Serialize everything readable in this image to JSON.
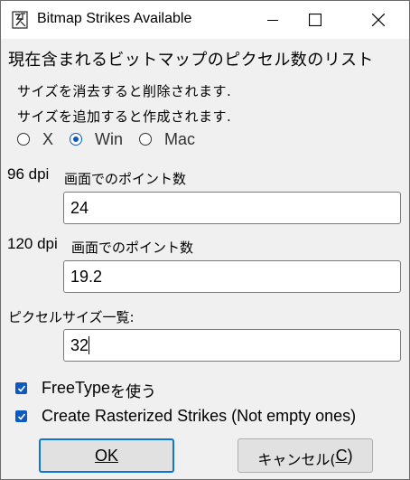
{
  "window": {
    "title": "Bitmap Strikes Available",
    "icon": "fontforge-app-icon"
  },
  "heading": "現在含まれるビットマップのピクセル数のリスト",
  "info": {
    "remove": "サイズを消去すると削除されます.",
    "add": "サイズを追加すると作成されます."
  },
  "radio": {
    "options": [
      "X",
      "Win",
      "Mac"
    ],
    "selected": "Win"
  },
  "dpi96": {
    "label": "96 dpi",
    "sublabel": "画面でのポイント数",
    "value": "24"
  },
  "dpi120": {
    "label": "120 dpi",
    "sublabel": "画面でのポイント数",
    "value": "19.2"
  },
  "pixel_sizes": {
    "label": "ピクセルサイズ一覧:",
    "value": "32"
  },
  "checkboxes": {
    "freetype": {
      "label_latin": "FreeType",
      "label_jp": "を使う",
      "checked": true
    },
    "rasterize": {
      "label": "Create Rasterized Strikes (Not empty ones)",
      "checked": true
    }
  },
  "buttons": {
    "ok": {
      "label": "OK",
      "mnemonic": "O"
    },
    "cancel": {
      "label": "キャンセル(",
      "mnemonic": "C",
      "suffix": ")"
    }
  },
  "colors": {
    "accent": "#0c59c4",
    "default_button_border": "#0c78d4"
  }
}
